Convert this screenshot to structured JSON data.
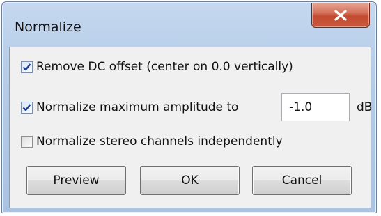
{
  "window": {
    "title": "Normalize"
  },
  "options": [
    {
      "label": "Remove DC offset (center on 0.0 vertically)",
      "checked": true
    },
    {
      "label": "Normalize maximum amplitude to",
      "checked": true
    },
    {
      "label": "Normalize stereo channels independently",
      "checked": false
    }
  ],
  "amplitude": {
    "value": "-1.0",
    "unit": "dB"
  },
  "buttons": {
    "preview": "Preview",
    "ok": "OK",
    "cancel": "Cancel"
  },
  "icons": {
    "close": "close-icon",
    "check": "checkmark-icon"
  },
  "colors": {
    "title_bar": "#b7cde8",
    "close_button": "#c24b30",
    "dialog_body": "#f0f0f0"
  }
}
